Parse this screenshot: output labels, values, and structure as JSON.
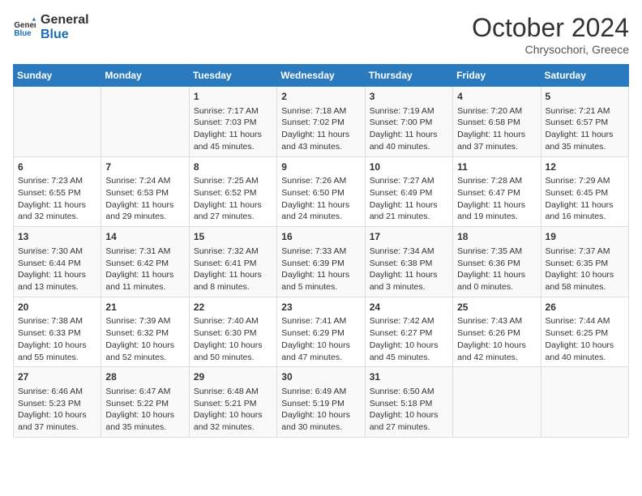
{
  "header": {
    "logo_line1": "General",
    "logo_line2": "Blue",
    "month": "October 2024",
    "location": "Chrysochori, Greece"
  },
  "days_of_week": [
    "Sunday",
    "Monday",
    "Tuesday",
    "Wednesday",
    "Thursday",
    "Friday",
    "Saturday"
  ],
  "weeks": [
    [
      {
        "day": "",
        "sunrise": "",
        "sunset": "",
        "daylight": ""
      },
      {
        "day": "",
        "sunrise": "",
        "sunset": "",
        "daylight": ""
      },
      {
        "day": "1",
        "sunrise": "Sunrise: 7:17 AM",
        "sunset": "Sunset: 7:03 PM",
        "daylight": "Daylight: 11 hours and 45 minutes."
      },
      {
        "day": "2",
        "sunrise": "Sunrise: 7:18 AM",
        "sunset": "Sunset: 7:02 PM",
        "daylight": "Daylight: 11 hours and 43 minutes."
      },
      {
        "day": "3",
        "sunrise": "Sunrise: 7:19 AM",
        "sunset": "Sunset: 7:00 PM",
        "daylight": "Daylight: 11 hours and 40 minutes."
      },
      {
        "day": "4",
        "sunrise": "Sunrise: 7:20 AM",
        "sunset": "Sunset: 6:58 PM",
        "daylight": "Daylight: 11 hours and 37 minutes."
      },
      {
        "day": "5",
        "sunrise": "Sunrise: 7:21 AM",
        "sunset": "Sunset: 6:57 PM",
        "daylight": "Daylight: 11 hours and 35 minutes."
      }
    ],
    [
      {
        "day": "6",
        "sunrise": "Sunrise: 7:23 AM",
        "sunset": "Sunset: 6:55 PM",
        "daylight": "Daylight: 11 hours and 32 minutes."
      },
      {
        "day": "7",
        "sunrise": "Sunrise: 7:24 AM",
        "sunset": "Sunset: 6:53 PM",
        "daylight": "Daylight: 11 hours and 29 minutes."
      },
      {
        "day": "8",
        "sunrise": "Sunrise: 7:25 AM",
        "sunset": "Sunset: 6:52 PM",
        "daylight": "Daylight: 11 hours and 27 minutes."
      },
      {
        "day": "9",
        "sunrise": "Sunrise: 7:26 AM",
        "sunset": "Sunset: 6:50 PM",
        "daylight": "Daylight: 11 hours and 24 minutes."
      },
      {
        "day": "10",
        "sunrise": "Sunrise: 7:27 AM",
        "sunset": "Sunset: 6:49 PM",
        "daylight": "Daylight: 11 hours and 21 minutes."
      },
      {
        "day": "11",
        "sunrise": "Sunrise: 7:28 AM",
        "sunset": "Sunset: 6:47 PM",
        "daylight": "Daylight: 11 hours and 19 minutes."
      },
      {
        "day": "12",
        "sunrise": "Sunrise: 7:29 AM",
        "sunset": "Sunset: 6:45 PM",
        "daylight": "Daylight: 11 hours and 16 minutes."
      }
    ],
    [
      {
        "day": "13",
        "sunrise": "Sunrise: 7:30 AM",
        "sunset": "Sunset: 6:44 PM",
        "daylight": "Daylight: 11 hours and 13 minutes."
      },
      {
        "day": "14",
        "sunrise": "Sunrise: 7:31 AM",
        "sunset": "Sunset: 6:42 PM",
        "daylight": "Daylight: 11 hours and 11 minutes."
      },
      {
        "day": "15",
        "sunrise": "Sunrise: 7:32 AM",
        "sunset": "Sunset: 6:41 PM",
        "daylight": "Daylight: 11 hours and 8 minutes."
      },
      {
        "day": "16",
        "sunrise": "Sunrise: 7:33 AM",
        "sunset": "Sunset: 6:39 PM",
        "daylight": "Daylight: 11 hours and 5 minutes."
      },
      {
        "day": "17",
        "sunrise": "Sunrise: 7:34 AM",
        "sunset": "Sunset: 6:38 PM",
        "daylight": "Daylight: 11 hours and 3 minutes."
      },
      {
        "day": "18",
        "sunrise": "Sunrise: 7:35 AM",
        "sunset": "Sunset: 6:36 PM",
        "daylight": "Daylight: 11 hours and 0 minutes."
      },
      {
        "day": "19",
        "sunrise": "Sunrise: 7:37 AM",
        "sunset": "Sunset: 6:35 PM",
        "daylight": "Daylight: 10 hours and 58 minutes."
      }
    ],
    [
      {
        "day": "20",
        "sunrise": "Sunrise: 7:38 AM",
        "sunset": "Sunset: 6:33 PM",
        "daylight": "Daylight: 10 hours and 55 minutes."
      },
      {
        "day": "21",
        "sunrise": "Sunrise: 7:39 AM",
        "sunset": "Sunset: 6:32 PM",
        "daylight": "Daylight: 10 hours and 52 minutes."
      },
      {
        "day": "22",
        "sunrise": "Sunrise: 7:40 AM",
        "sunset": "Sunset: 6:30 PM",
        "daylight": "Daylight: 10 hours and 50 minutes."
      },
      {
        "day": "23",
        "sunrise": "Sunrise: 7:41 AM",
        "sunset": "Sunset: 6:29 PM",
        "daylight": "Daylight: 10 hours and 47 minutes."
      },
      {
        "day": "24",
        "sunrise": "Sunrise: 7:42 AM",
        "sunset": "Sunset: 6:27 PM",
        "daylight": "Daylight: 10 hours and 45 minutes."
      },
      {
        "day": "25",
        "sunrise": "Sunrise: 7:43 AM",
        "sunset": "Sunset: 6:26 PM",
        "daylight": "Daylight: 10 hours and 42 minutes."
      },
      {
        "day": "26",
        "sunrise": "Sunrise: 7:44 AM",
        "sunset": "Sunset: 6:25 PM",
        "daylight": "Daylight: 10 hours and 40 minutes."
      }
    ],
    [
      {
        "day": "27",
        "sunrise": "Sunrise: 6:46 AM",
        "sunset": "Sunset: 5:23 PM",
        "daylight": "Daylight: 10 hours and 37 minutes."
      },
      {
        "day": "28",
        "sunrise": "Sunrise: 6:47 AM",
        "sunset": "Sunset: 5:22 PM",
        "daylight": "Daylight: 10 hours and 35 minutes."
      },
      {
        "day": "29",
        "sunrise": "Sunrise: 6:48 AM",
        "sunset": "Sunset: 5:21 PM",
        "daylight": "Daylight: 10 hours and 32 minutes."
      },
      {
        "day": "30",
        "sunrise": "Sunrise: 6:49 AM",
        "sunset": "Sunset: 5:19 PM",
        "daylight": "Daylight: 10 hours and 30 minutes."
      },
      {
        "day": "31",
        "sunrise": "Sunrise: 6:50 AM",
        "sunset": "Sunset: 5:18 PM",
        "daylight": "Daylight: 10 hours and 27 minutes."
      },
      {
        "day": "",
        "sunrise": "",
        "sunset": "",
        "daylight": ""
      },
      {
        "day": "",
        "sunrise": "",
        "sunset": "",
        "daylight": ""
      }
    ]
  ]
}
